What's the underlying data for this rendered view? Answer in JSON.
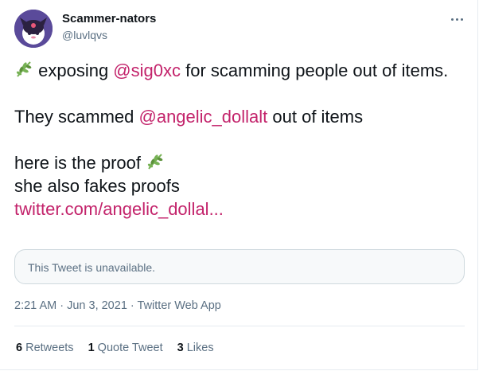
{
  "author": {
    "display_name": "Scammer-nators",
    "handle": "@luvlqvs",
    "avatar_icon": "cartoon-character-avatar"
  },
  "more_icon": "more-horizontal-icon",
  "tweet": {
    "line1_pre": " exposing ",
    "line1_mention": "@sig0xc",
    "line1_post": " for scamming people out of items.",
    "line2_pre": "They scammed ",
    "line2_mention": "@angelic_dollalt",
    "line2_post": " out of items",
    "line3_text": "here is the proof ",
    "line4_text": "she also fakes proofs",
    "link_text": "twitter.com/angelic_dollal...",
    "emoji_icon": "herb-emoji-icon"
  },
  "quote": {
    "text": "This Tweet is unavailable."
  },
  "meta": {
    "time": "2:21 AM",
    "sep1": " · ",
    "date": "Jun 3, 2021",
    "sep2": " · ",
    "source": "Twitter Web App"
  },
  "stats": {
    "retweets_count": "6",
    "retweets_label": " Retweets",
    "quotes_count": "1",
    "quotes_label": " Quote Tweet",
    "likes_count": "3",
    "likes_label": " Likes"
  },
  "colors": {
    "link": "#c3236b",
    "muted": "#5b7083",
    "text": "#0f1419"
  }
}
